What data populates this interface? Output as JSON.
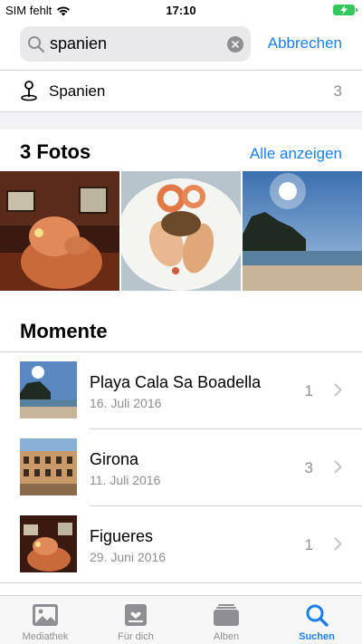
{
  "status": {
    "carrier": "SIM fehlt",
    "time": "17:10"
  },
  "search": {
    "query": "spanien",
    "cancel_label": "Abbrechen"
  },
  "place_result": {
    "label": "Spanien",
    "count": "3"
  },
  "photos_section": {
    "title": "3 Fotos",
    "show_all_label": "Alle anzeigen"
  },
  "moments_section": {
    "title": "Momente",
    "items": [
      {
        "title": "Playa Cala Sa Boadella",
        "date": "16. Juli 2016",
        "count": "1"
      },
      {
        "title": "Girona",
        "date": "11. Juli 2016",
        "count": "3"
      },
      {
        "title": "Figueres",
        "date": "29. Juni 2016",
        "count": "1"
      }
    ]
  },
  "tab_bar": {
    "tabs": [
      {
        "label": "Mediathek",
        "icon": "photo-library-icon"
      },
      {
        "label": "Für dich",
        "icon": "for-you-icon"
      },
      {
        "label": "Alben",
        "icon": "albums-icon"
      },
      {
        "label": "Suchen",
        "icon": "search-icon"
      }
    ],
    "active": "Suchen"
  },
  "colors": {
    "accent": "#1a7ff0",
    "secondary_text": "#8e8e93",
    "battery": "#34c759"
  }
}
